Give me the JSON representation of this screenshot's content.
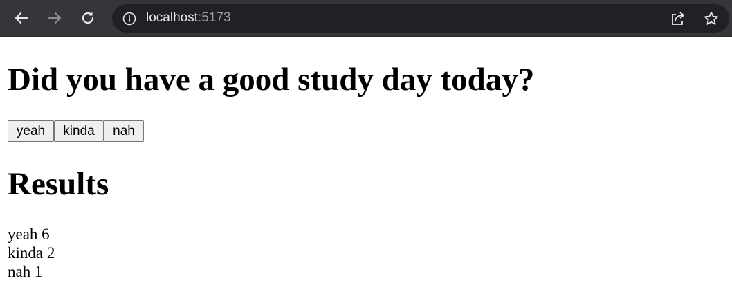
{
  "browser": {
    "url_host": "localhost",
    "url_port": ":5173"
  },
  "page": {
    "question": "Did you have a good study day today?",
    "buttons": [
      "yeah",
      "kinda",
      "nah"
    ],
    "results_heading": "Results",
    "results": [
      {
        "label": "yeah",
        "count": "6"
      },
      {
        "label": "kinda",
        "count": "2"
      },
      {
        "label": "nah",
        "count": "1"
      }
    ]
  }
}
